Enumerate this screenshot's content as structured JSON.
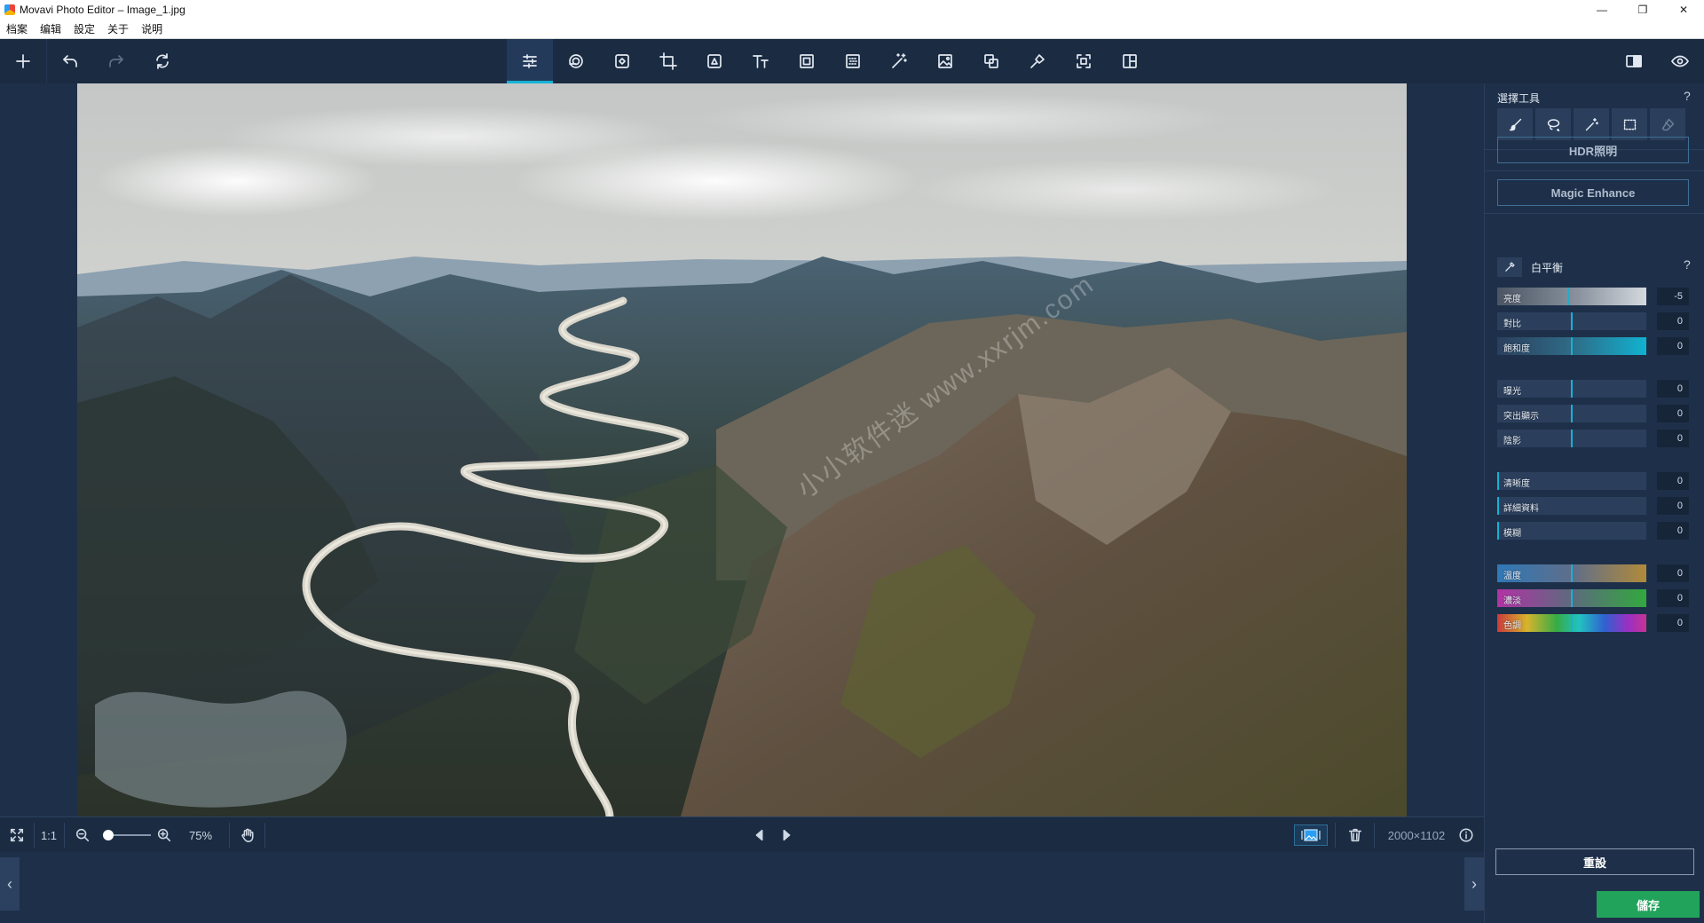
{
  "window": {
    "title": "Movavi Photo Editor – Image_1.jpg"
  },
  "menu": [
    "档案",
    "编辑",
    "設定",
    "关于",
    "说明"
  ],
  "toolbar": {
    "left": [
      "add-icon",
      "undo-icon",
      "redo-icon",
      "rotate-icon"
    ],
    "center": [
      "adjust-icon",
      "filters-icon",
      "retouch-icon",
      "crop-icon",
      "background-icon",
      "text-icon",
      "frames-icon",
      "noise-icon",
      "magic-wand-icon",
      "image-icon",
      "objects-icon",
      "pin-icon",
      "resize-icon",
      "layout-icon"
    ],
    "right": [
      "compare-icon",
      "eye-icon"
    ]
  },
  "canvas": {
    "watermark": "小小软件迷 www.xxrjm.com"
  },
  "bottombar": {
    "one_to_one": "1:1",
    "zoom_percent": "75%",
    "zoom_level": 0.25,
    "image_size": "2000×1102"
  },
  "panel": {
    "section_title": "選擇工具",
    "help": "?",
    "hdr_button": "HDR照明",
    "magic_button": "Magic Enhance",
    "wb_label": "白平衡",
    "sliders": [
      {
        "label": "亮度",
        "value": "-5",
        "pos": 0.48
      },
      {
        "label": "對比",
        "value": "0",
        "pos": 0.5
      },
      {
        "label": "飽和度",
        "value": "0",
        "pos": 0.5
      },
      {
        "label": "曝光",
        "value": "0",
        "pos": 0.5
      },
      {
        "label": "突出顯示",
        "value": "0",
        "pos": 0.5
      },
      {
        "label": "陰影",
        "value": "0",
        "pos": 0.5
      },
      {
        "label": "清晰度",
        "value": "0",
        "pos": 0
      },
      {
        "label": "詳細資料",
        "value": "0",
        "pos": 0
      },
      {
        "label": "模糊",
        "value": "0",
        "pos": 0
      },
      {
        "label": "溫度",
        "value": "0",
        "pos": 0.5
      },
      {
        "label": "濃淡",
        "value": "0",
        "pos": 0.5
      },
      {
        "label": "色調",
        "value": "0",
        "pos": 0.5
      }
    ],
    "reset_button": "重設",
    "save_button": "儲存"
  },
  "colors": {
    "accent": "#15b2d3",
    "save": "#21a35c",
    "background": "#1e3049",
    "toolbar": "#1a2b42"
  }
}
